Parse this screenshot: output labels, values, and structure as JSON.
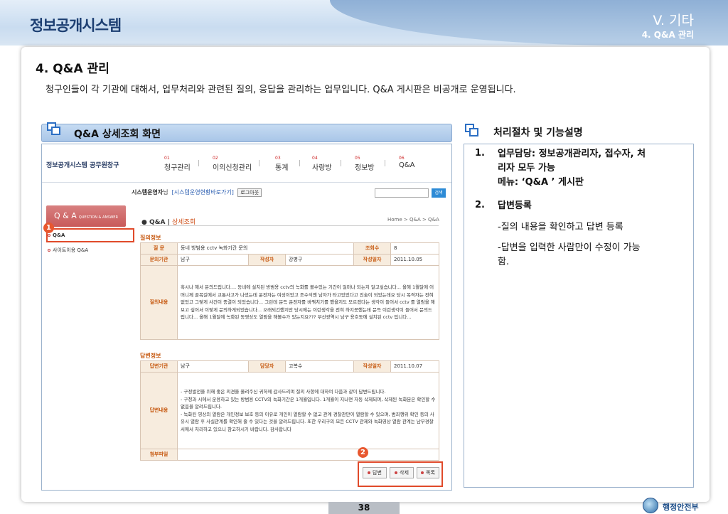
{
  "header": {
    "brand": "정보공개시스템",
    "section": "V. 기타",
    "subsection": "4. Q&A 관리"
  },
  "main": {
    "heading": "4. Q&A 관리",
    "description": "청구인들이 각 기관에 대해서, 업무처리와 관련된 질의, 응답을 관리하는 업무입니다. Q&A 게시판은 비공개로 운영됩니다.",
    "left_label": "Q&A 상세조회 화면",
    "right_label": "처리절차 및 기능설명"
  },
  "screenshot": {
    "logo": "정보공개시스템 공무원창구",
    "nav": [
      {
        "num": "01",
        "label": "청구관리"
      },
      {
        "num": "02",
        "label": "이의신청관리"
      },
      {
        "num": "03",
        "label": "통계"
      },
      {
        "num": "04",
        "label": "사랑방"
      },
      {
        "num": "05",
        "label": "정보방"
      },
      {
        "num": "06",
        "label": "Q&A"
      }
    ],
    "admin_name": "시스템운영자",
    "admin_suffix": "님",
    "admin_link": "[시스템운영현황바로가기]",
    "logout": "로그아웃",
    "search_btn": "검색",
    "side_head": "Q & A",
    "side_head_small": "QUESTION & ANSWER",
    "side_items": [
      "Q&A",
      "사이트이용 Q&A"
    ],
    "content_title": "Q&A",
    "content_sub": "상세조회",
    "content_path": "Home > Q&A > Q&A",
    "question_section": "질의정보",
    "question": {
      "subject_label": "질 문",
      "subject": "동네 방범용 cctv 녹화기간 문의",
      "views_label": "조회수",
      "views": "8",
      "org_label": "문의기관",
      "org": "남구",
      "author_label": "작성자",
      "author": "강병구",
      "date_label": "작성일자",
      "date": "2011.10.05",
      "content_label": "질의내용",
      "content": "혹시나 해서 문의드립니다.... 동네에 설치된 방범용 cctv의 녹화를 볼수있는 기간이 얼마나 되는지 알고싶습니다... 올해 1월달에 어머니께 골목길에서 교통사고가 나셨는데 운전자는 여성이었고 조수석엔 남자가 타고있었다고 진술이 되었는데요 당시 목격자는 전혀 없었고 그렇게 사건이 종결이 되었습니다... 그런데 문득 운전자를 바꿔치기를 했을지도 모르겠다는 생각이 들어서 cctv 를 열람을 해보고 싶어서 이렇게 문의하게되었습니다... 오래되긴했지만 당시에는 이런생각을 전혀 하지못했는데 문득 이런생각이 들어서 문의드립니다... 올해 1월달에 녹화된 동영상도 열람을 해볼수가 있는지요??? 부산광역시 남구 용호동에 설치된 cctv 입니다..."
    },
    "answer_section": "답변정보",
    "answer": {
      "org_label": "답변기관",
      "org": "남구",
      "handler_label": "담당자",
      "handler": "고복수",
      "date_label": "작성일자",
      "date": "2011.10.07",
      "content_label": "답변내용",
      "content": "- 구정발전을 위해 좋은 의견을 올려주신 귀하께 감사드리며 질의 사항에 대하여 다음과 같이 답변드립니다.\n- 구청과 시에서 운용하고 있는 방범용 CCTV의 녹화기간은 1개월입니다. 1개월이 지나면 자동 삭제되며, 삭제된 녹화분은 확인할 수 없음을 알려드립니다.\n- 녹화된 영상의 열람은 개인정보 보호 등의 이유로 개인이 열람할 수 없고 관계 경찰관만이 열람할 수 있으며, 범죄행위 확인 등의 사유시 열람 후 사실관계를 확인해 줄 수 있다는 것을 알려드립니다. 또한 우리구의 모든 CCTV 관제와 녹화영상 열람 관계는 남부경찰서에서 처리하고 있으니 참고하시기 바랍니다. 감사합니다",
      "attach_label": "첨부파일"
    },
    "buttons": [
      "답변",
      "삭제",
      "목록"
    ],
    "badge1": "1",
    "badge2": "2"
  },
  "procedure": {
    "item1_num": "1.",
    "item1_line1": "업무담당: 정보공개관리자, 접수자, 처",
    "item1_line2": "리자 모두 가능",
    "item1_line3": "메뉴: ‘Q&A ’ 게시판",
    "item2_num": "2.",
    "item2_title": "답변등록",
    "item2_d1": "-질의 내용을 확인하고 답변 등록",
    "item2_d2_line1": "-답변을 입력한 사람만이 수정이 가능",
    "item2_d2_line2": "함."
  },
  "footer": {
    "page": "38",
    "ministry": "행정안전부"
  }
}
